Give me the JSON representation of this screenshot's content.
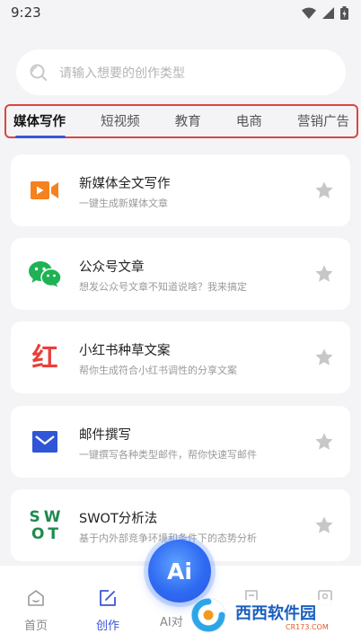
{
  "status_bar": {
    "time": "9:23"
  },
  "search": {
    "placeholder": "请输入想要的创作类型"
  },
  "tabs": [
    {
      "label": "媒体写作",
      "active": true
    },
    {
      "label": "短视频",
      "active": false
    },
    {
      "label": "教育",
      "active": false
    },
    {
      "label": "电商",
      "active": false
    },
    {
      "label": "营销广告",
      "active": false
    }
  ],
  "cards": [
    {
      "title": "新媒体全文写作",
      "desc": "一键生成新媒体文章",
      "icon": "video-camera-icon",
      "color": "#f5821f"
    },
    {
      "title": "公众号文章",
      "desc": "想发公众号文章不知道说啥？我来搞定",
      "icon": "wechat-icon",
      "color": "#1fb254"
    },
    {
      "title": "小红书种草文案",
      "desc": "帮你生成符合小红书调性的分享文案",
      "icon": "xiaohongshu-icon",
      "color": "#e8403a"
    },
    {
      "title": "邮件撰写",
      "desc": "一键撰写各种类型邮件，帮你快速写邮件",
      "icon": "mail-icon",
      "color": "#2f56d6"
    },
    {
      "title": "SWOT分析法",
      "desc": "基于内外部竞争环境和条件下的态势分析",
      "icon": "swot-icon",
      "color": "#1e8a4e"
    }
  ],
  "xhs_icon_glyph": "红",
  "swot_glyph": {
    "top": "SW",
    "bottom": "OT"
  },
  "bottom_nav": [
    {
      "label": "首页",
      "active": false
    },
    {
      "label": "创作",
      "active": true
    },
    {
      "label": "AI对",
      "active": false
    }
  ],
  "ai_button": {
    "label": "Ai"
  },
  "watermark": {
    "text_main": "西西软件园",
    "text_sub": "CR173.COM"
  },
  "colors": {
    "accent": "#3a55d9",
    "tabs_border": "#d9473f",
    "star": "#c7c7c7"
  }
}
